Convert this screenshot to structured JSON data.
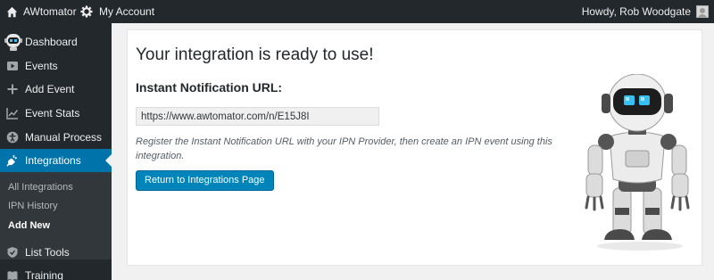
{
  "admin_bar": {
    "site_name": "AWtomator",
    "my_account": "My Account",
    "howdy": "Howdy, Rob Woodgate"
  },
  "sidebar": {
    "items": [
      {
        "label": "Dashboard",
        "icon": "robot-icon"
      },
      {
        "label": "Events",
        "icon": "play-icon"
      },
      {
        "label": "Add Event",
        "icon": "plus-icon"
      },
      {
        "label": "Event Stats",
        "icon": "chart-icon"
      },
      {
        "label": "Manual Process",
        "icon": "accessibility-icon"
      },
      {
        "label": "Integrations",
        "icon": "plug-icon"
      },
      {
        "label": "List Tools",
        "icon": "shield-icon"
      },
      {
        "label": "Training",
        "icon": "book-icon"
      }
    ],
    "submenu": [
      {
        "label": "All Integrations"
      },
      {
        "label": "IPN History"
      },
      {
        "label": "Add New"
      }
    ],
    "active_color": "#0073aa"
  },
  "main": {
    "title": "Your integration is ready to use!",
    "subtitle": "Instant Notification URL:",
    "url_value": "https://www.awtomator.com/n/E15J8I",
    "help_text": "Register the Instant Notification URL with your IPN Provider, then create an IPN event using this integration.",
    "return_button": "Return to Integrations Page"
  }
}
